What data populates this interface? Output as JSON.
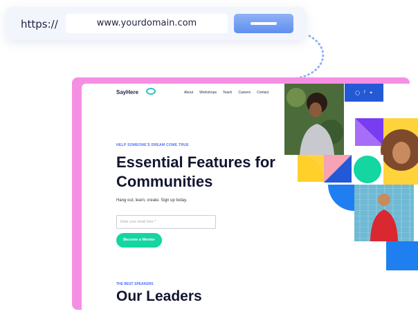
{
  "urlbar": {
    "protocol": "https://",
    "domain": "www.yourdomain.com",
    "go_icon": "minus-bar-icon"
  },
  "site": {
    "logo": "SayHere",
    "nav": [
      "About",
      "Workshops",
      "Teach",
      "Careers",
      "Contact"
    ],
    "eyebrow": "HELP SOMEONE'S DREAM COME TRUE",
    "headline": "Essential Features for Communities",
    "subline": "Hang out, learn, create. Sign up today.",
    "email_placeholder": "Enter your email here *",
    "cta": "Become a Mentor",
    "leaders_eyebrow": "THE BEST SPEAKERS",
    "leaders_title": "Our Leaders",
    "social_icons": [
      "instagram-icon",
      "facebook-icon",
      "twitter-icon"
    ]
  },
  "colors": {
    "pink_frame": "#f58fe4",
    "accent_blue": "#2459d6",
    "cta_green": "#13d6a0",
    "eyebrow_blue": "#4a6cf7"
  }
}
